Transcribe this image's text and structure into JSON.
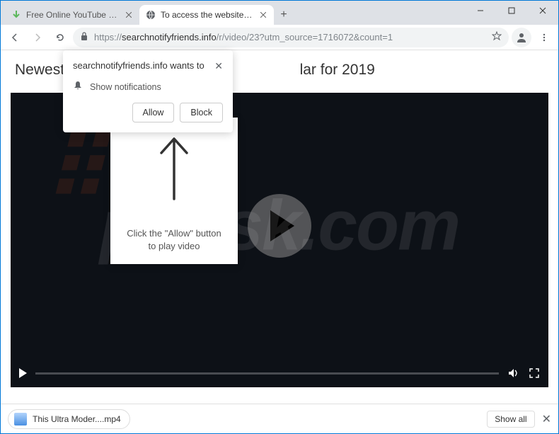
{
  "window": {
    "minimize": "—",
    "maximize": "▢",
    "close": "✕"
  },
  "tabs": [
    {
      "title": "Free Online YouTube Downloade",
      "active": false
    },
    {
      "title": "To access the website click the \"A",
      "active": true
    }
  ],
  "url": {
    "protocol": "https://",
    "domain": "searchnotifyfriends.info",
    "path": "/r/video/23?utm_source=1716072&count=1"
  },
  "page_title": "Newest                                                         lar for 2019",
  "notification": {
    "title": "searchnotifyfriends.info wants to",
    "permission": "Show notifications",
    "allow": "Allow",
    "block": "Block"
  },
  "allow_overlay": {
    "text_line1": "Click the \"Allow\" button",
    "text_line2": "to play video"
  },
  "download": {
    "filename": "This Ultra Moder....mp4",
    "show_all": "Show all"
  },
  "watermark": "pcrisk.com"
}
